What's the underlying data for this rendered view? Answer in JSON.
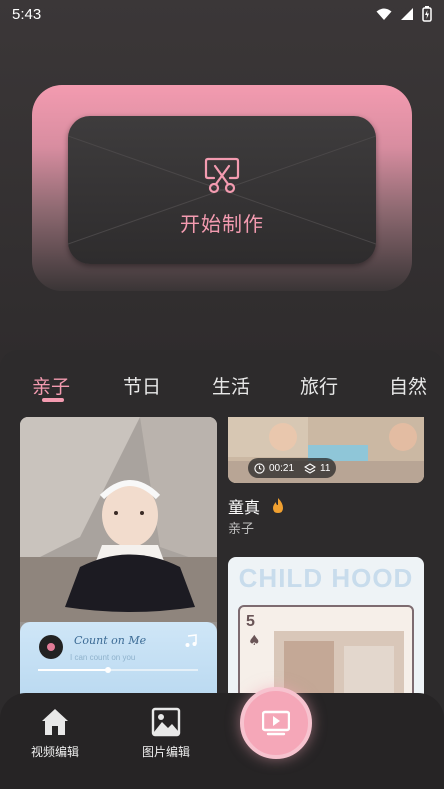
{
  "status_bar": {
    "time": "5:43"
  },
  "hero": {
    "label": "开始制作"
  },
  "tabs": [
    {
      "label": "亲子"
    },
    {
      "label": "节日"
    },
    {
      "label": "生活"
    },
    {
      "label": "旅行"
    },
    {
      "label": "自然"
    }
  ],
  "active_tab": "亲子",
  "cards": {
    "left": {
      "music_title": "Count on Me",
      "music_subtitle": "I can count on you"
    },
    "right_top": {
      "duration": "00:21",
      "layers": "11",
      "title": "童真",
      "category": "亲子"
    },
    "right_bottom": {
      "banner": "CHILD HOOD",
      "card_number": "5",
      "card_suit": "♠"
    }
  },
  "bottom_nav": {
    "video_edit": "视频编辑",
    "image_edit": "图片编辑"
  },
  "colors": {
    "accent": "#f39bb0",
    "background": "#2d2b2c"
  }
}
